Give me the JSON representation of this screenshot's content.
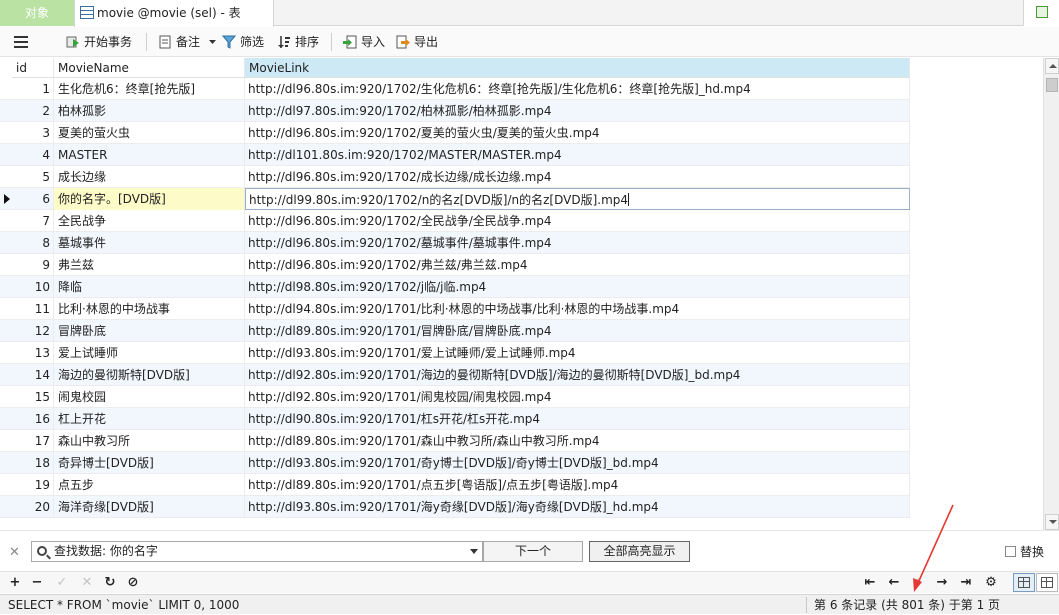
{
  "tabs": {
    "objects": "对象",
    "table": "movie @movie (sel) - 表"
  },
  "toolbar": {
    "begin_transaction": "开始事务",
    "memo": "备注",
    "filter": "筛选",
    "sort": "排序",
    "import": "导入",
    "export": "导出"
  },
  "columns": [
    "id",
    "MovieName",
    "MovieLink"
  ],
  "rows": [
    {
      "id": "1",
      "name": "生化危机6：终章[抢先版]",
      "link": "http://dl96.80s.im:920/1702/生化危机6：终章[抢先版]/生化危机6：终章[抢先版]_hd.mp4"
    },
    {
      "id": "2",
      "name": "柏林孤影",
      "link": "http://dl97.80s.im:920/1702/柏林孤影/柏林孤影.mp4"
    },
    {
      "id": "3",
      "name": "夏美的萤火虫",
      "link": "http://dl96.80s.im:920/1702/夏美的萤火虫/夏美的萤火虫.mp4"
    },
    {
      "id": "4",
      "name": "MASTER",
      "link": "http://dl101.80s.im:920/1702/MASTER/MASTER.mp4"
    },
    {
      "id": "5",
      "name": "成长边缘",
      "link": "http://dl96.80s.im:920/1702/成长边缘/成长边缘.mp4"
    },
    {
      "id": "6",
      "name": "你的名字。[DVD版]",
      "link": "http://dl99.80s.im:920/1702/n的名z[DVD版]/n的名z[DVD版].mp4"
    },
    {
      "id": "7",
      "name": "全民战争",
      "link": "http://dl96.80s.im:920/1702/全民战争/全民战争.mp4"
    },
    {
      "id": "8",
      "name": "墓城事件",
      "link": "http://dl96.80s.im:920/1702/墓城事件/墓城事件.mp4"
    },
    {
      "id": "9",
      "name": "弗兰兹",
      "link": "http://dl96.80s.im:920/1702/弗兰兹/弗兰兹.mp4"
    },
    {
      "id": "10",
      "name": "降临",
      "link": "http://dl98.80s.im:920/1702/j临/j临.mp4"
    },
    {
      "id": "11",
      "name": "比利·林恩的中场战事",
      "link": "http://dl94.80s.im:920/1701/比利·林恩的中场战事/比利·林恩的中场战事.mp4"
    },
    {
      "id": "12",
      "name": "冒牌卧底",
      "link": "http://dl89.80s.im:920/1701/冒牌卧底/冒牌卧底.mp4"
    },
    {
      "id": "13",
      "name": "爱上试睡师",
      "link": "http://dl93.80s.im:920/1701/爱上试睡师/爱上试睡师.mp4"
    },
    {
      "id": "14",
      "name": "海边的曼彻斯特[DVD版]",
      "link": "http://dl92.80s.im:920/1701/海边的曼彻斯特[DVD版]/海边的曼彻斯特[DVD版]_bd.mp4"
    },
    {
      "id": "15",
      "name": "闹鬼校园",
      "link": "http://dl92.80s.im:920/1701/闹鬼校园/闹鬼校园.mp4"
    },
    {
      "id": "16",
      "name": "杠上开花",
      "link": "http://dl90.80s.im:920/1701/杠s开花/杠s开花.mp4"
    },
    {
      "id": "17",
      "name": "森山中教习所",
      "link": "http://dl89.80s.im:920/1701/森山中教习所/森山中教习所.mp4"
    },
    {
      "id": "18",
      "name": "奇异博士[DVD版]",
      "link": "http://dl93.80s.im:920/1701/奇y博士[DVD版]/奇y博士[DVD版]_bd.mp4"
    },
    {
      "id": "19",
      "name": "点五步",
      "link": "http://dl89.80s.im:920/1701/点五步[粤语版]/点五步[粤语版].mp4"
    },
    {
      "id": "20",
      "name": "海洋奇缘[DVD版]",
      "link": "http://dl93.80s.im:920/1701/海y奇缘[DVD版]/海y奇缘[DVD版]_hd.mp4"
    }
  ],
  "find": {
    "query": "查找数据: 你的名字",
    "next": "下一个",
    "highlight_all": "全部高亮显示",
    "replace": "替换"
  },
  "status": {
    "sql": "SELECT * FROM `movie` LIMIT 0, 1000",
    "records": "第 6 条记录 (共 801 条) 于第 1 页"
  },
  "colors": {
    "objects_tab": "#b9e2a3",
    "header_active": "#cde9f6",
    "alt_row": "#f2f7fd",
    "selected_cell": "#fdfbc7",
    "annotation_arrow": "#e53935"
  }
}
